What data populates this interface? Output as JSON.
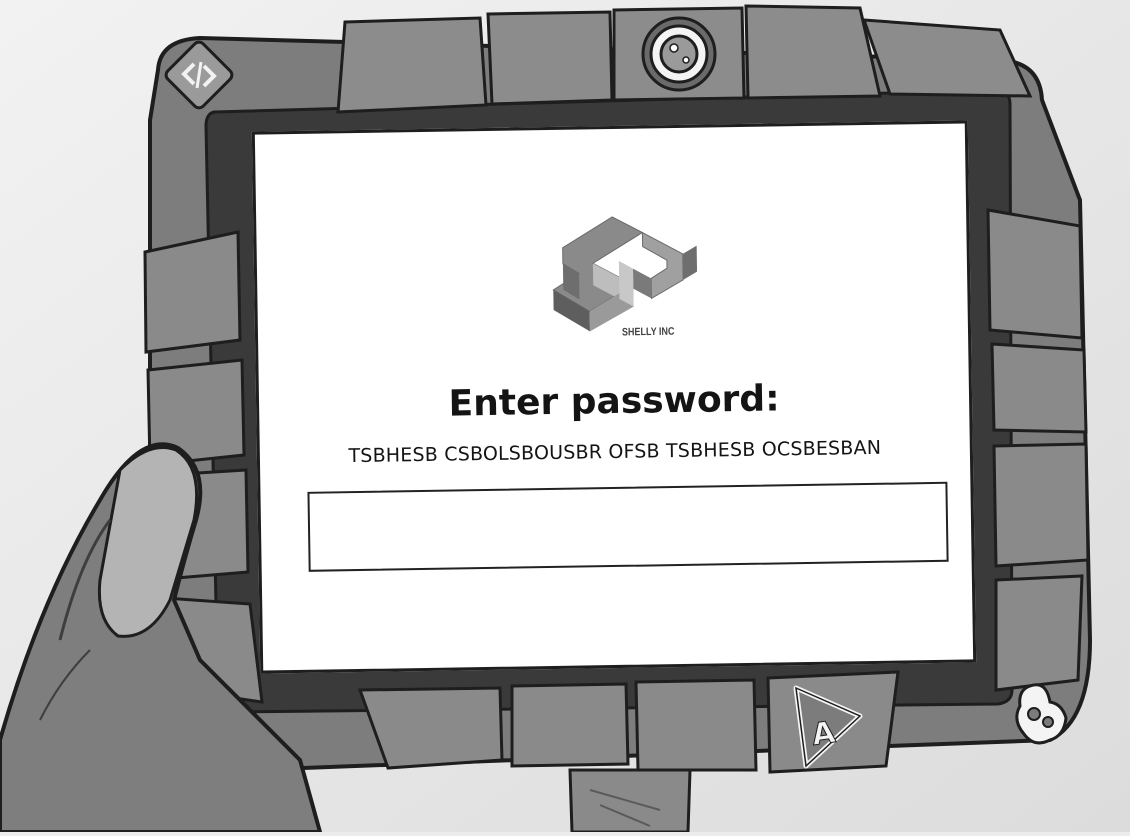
{
  "screen": {
    "company_name": "SHELLY INC",
    "prompt": "Enter password:",
    "cipher_text": "TSBHESB CSBOLSBOUSBR OFSB TSBHESB OCSBESBAN",
    "password_value": ""
  },
  "icons": {
    "top_left": "code-brackets-icon",
    "top_center": "camera-lens-icon",
    "bottom_center": "letter-a-triangle-icon",
    "bottom_right": "power-plug-icon"
  },
  "colors": {
    "frame": "#7a7a7a",
    "frame_dark": "#3b3b3b",
    "screen_bg": "#ffffff",
    "text": "#141414"
  }
}
